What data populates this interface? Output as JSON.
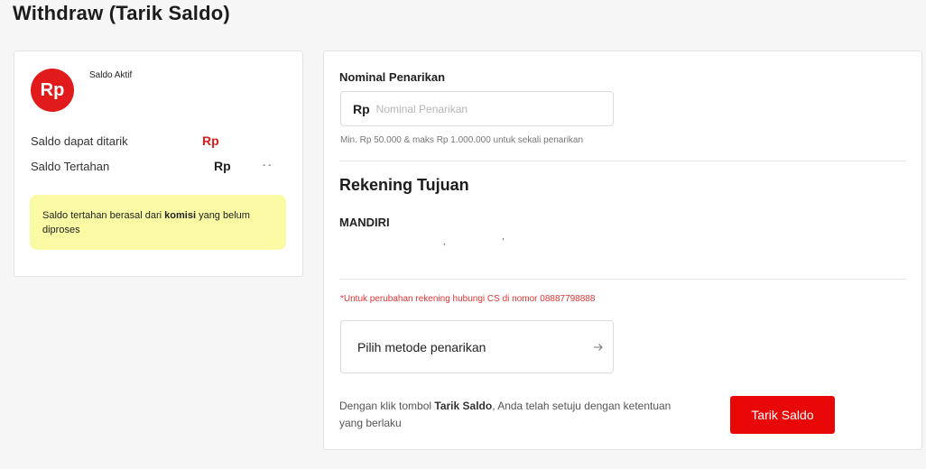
{
  "page": {
    "title": "Withdraw (Tarik Saldo)"
  },
  "balance_card": {
    "icon_text": "Rp",
    "saldo_aktif_label": "Saldo Aktif",
    "rows": [
      {
        "label": "Saldo dapat ditarik",
        "value": "Rp",
        "value_color": "#e11b1b"
      },
      {
        "label": "Saldo Tertahan",
        "value": "Rp",
        "value_color": "#222222",
        "suffix": "- -"
      }
    ],
    "info_text_before": "Saldo tertahan berasal dari ",
    "info_text_bold": "komisi",
    "info_text_after": " yang belum diproses"
  },
  "withdraw_form": {
    "nominal_label": "Nominal Penarikan",
    "currency_prefix": "Rp",
    "nominal_placeholder": "Nominal Penarikan",
    "nominal_value": "",
    "hint": "Min. Rp 50.000 & maks Rp 1.000.000 untuk sekali penarikan",
    "section_title": "Rekening Tujuan",
    "bank_name": "MANDIRI",
    "account_mask": ", '",
    "cs_note": "*Untuk perubahan rekening hubungi CS di nomor 08887798888",
    "method_label": "Pilih metode penarikan",
    "terms_before": "Dengan klik tombol ",
    "terms_bold": "Tarik Saldo",
    "terms_after": ", Anda telah setuju dengan ketentuan yang berlaku",
    "submit_label": "Tarik Saldo"
  },
  "colors": {
    "brand_red": "#e80808",
    "info_yellow": "#fbfaa4",
    "note_red": "#e33434"
  }
}
